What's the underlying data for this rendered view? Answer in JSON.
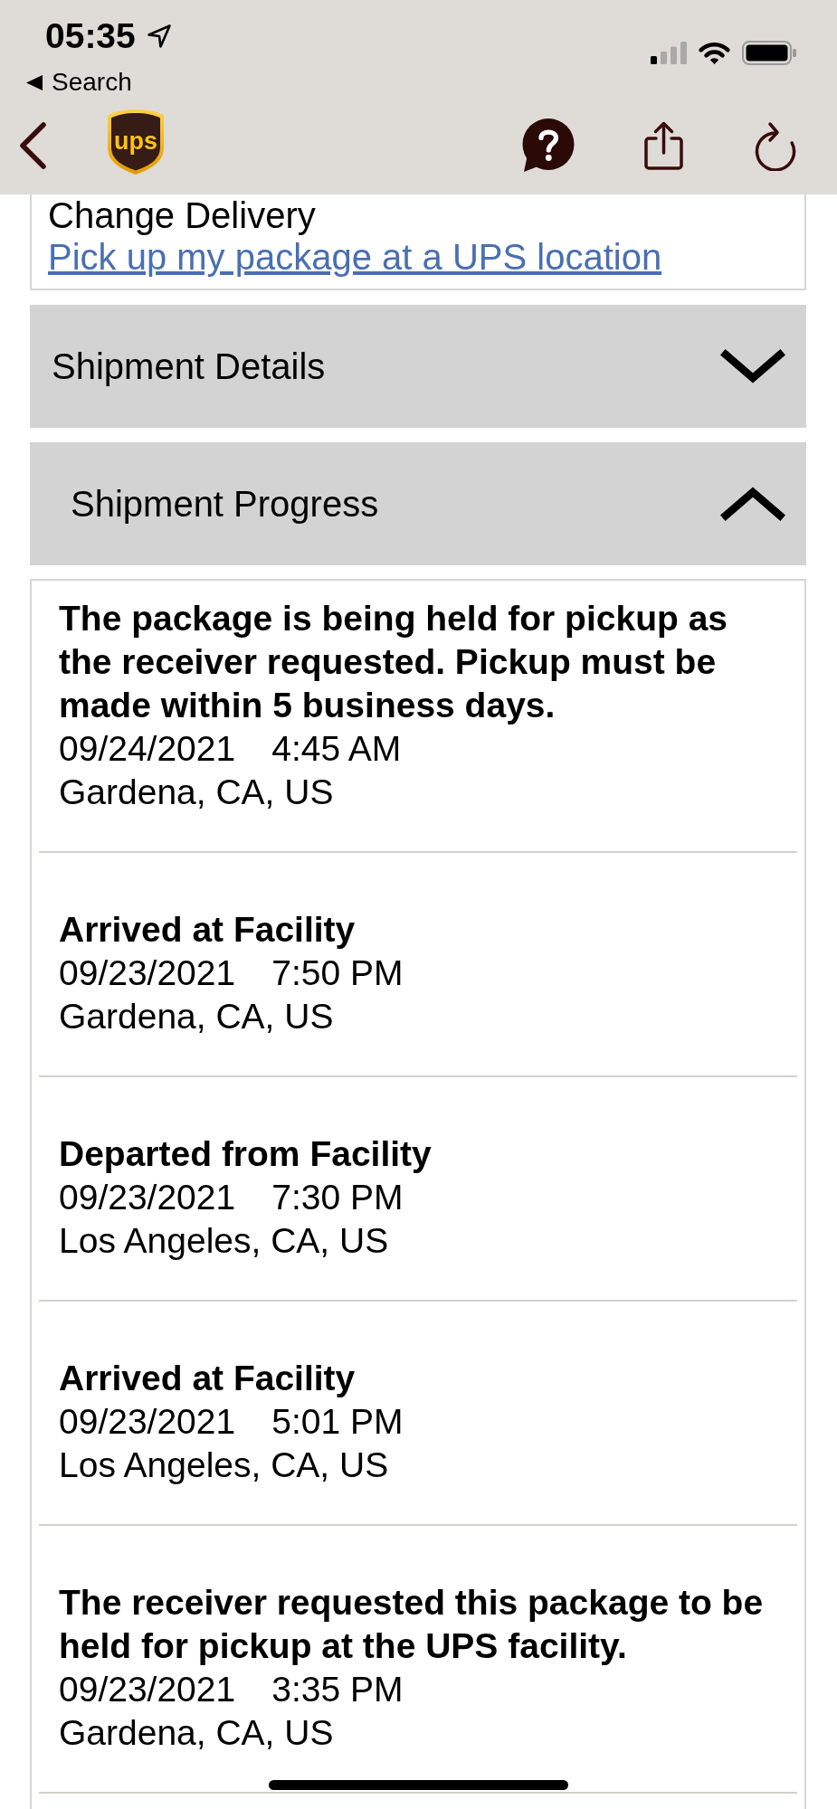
{
  "status_bar": {
    "time": "05:35",
    "back_to_app": "Search"
  },
  "nav": {
    "logo": "ups"
  },
  "delivery_card": {
    "heading": "Change Delivery",
    "link": "Pick up my package at a UPS location"
  },
  "sections": [
    {
      "title": "Shipment Details",
      "expanded": false
    },
    {
      "title": "Shipment Progress",
      "expanded": true,
      "events": [
        {
          "description": "The package is being held for pickup as the receiver requested. Pickup must be made within 5 business days.",
          "date": "09/24/2021",
          "time": "4:45 AM",
          "location": "Gardena, CA, US"
        },
        {
          "description": "Arrived at Facility",
          "date": "09/23/2021",
          "time": "7:50 PM",
          "location": "Gardena, CA, US"
        },
        {
          "description": "Departed from Facility",
          "date": "09/23/2021",
          "time": "7:30 PM",
          "location": "Los Angeles, CA, US"
        },
        {
          "description": "Arrived at Facility",
          "date": "09/23/2021",
          "time": "5:01 PM",
          "location": "Los Angeles, CA, US"
        },
        {
          "description": "The receiver requested this package to be held for pickup at the UPS facility.",
          "date": "09/23/2021",
          "time": "3:35 PM",
          "location": "Gardena, CA, US"
        }
      ]
    }
  ]
}
